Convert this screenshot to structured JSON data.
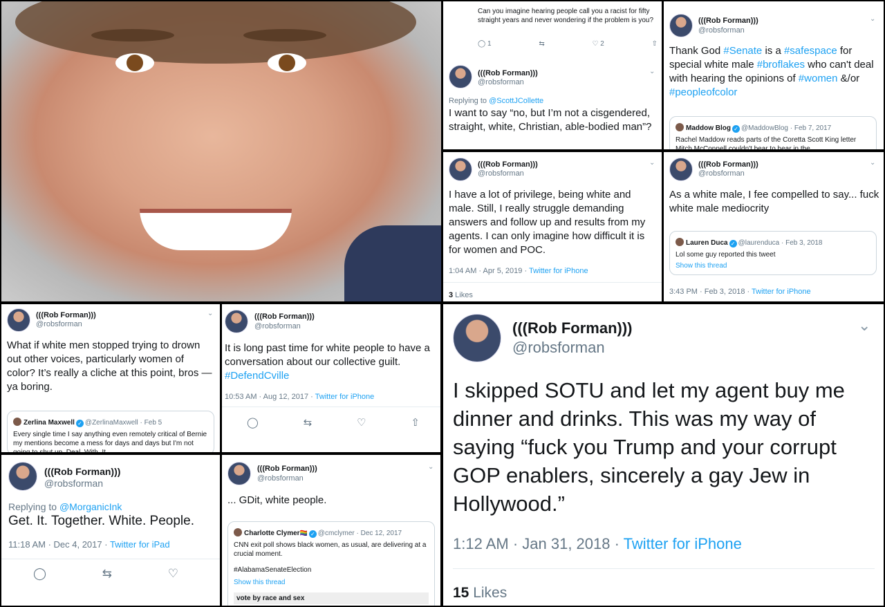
{
  "p2": {
    "quoted_text": "Can you imagine hearing people call you a racist for fifty straight years and never wondering if the problem is you?",
    "reply_count": "1",
    "like_count": "2",
    "name": "(((Rob Forman)))",
    "handle": "@robsforman",
    "replying_prefix": "Replying to ",
    "replying_to": "@ScottJCollette",
    "text": "I want to say “no, but I’m not a cisgendered, straight, white, Christian, able-bodied man”?"
  },
  "p3": {
    "name": "(((Rob Forman)))",
    "handle": "@robsforman",
    "text_1": "Thank God ",
    "tag_1": "#Senate",
    "text_2": " is a ",
    "tag_2": "#safespace",
    "text_3": " for special white male ",
    "tag_3": "#broflakes",
    "text_4": " who can't deal with hearing the opinions of ",
    "tag_4": "#women",
    "text_5": " &/or ",
    "tag_5": "#peopleofcolor",
    "quote_name": "Maddow Blog",
    "quote_handle": "@MaddowBlog · Feb 7, 2017",
    "quote_text": "Rachel Maddow reads parts of the Coretta Scott King letter Mitch McConnell couldn't bear to hear in the"
  },
  "p4": {
    "name": "(((Rob Forman)))",
    "handle": "@robsforman",
    "text": "I have a lot of privilege, being white and male. Still, I really struggle demanding answers and follow up and results from my agents. I can only imagine how difficult it is for women and POC.",
    "time": "1:04 AM · Apr 5, 2019 · ",
    "source": "Twitter for iPhone",
    "likes_count": "3",
    "likes_label": " Likes"
  },
  "p5": {
    "name": "(((Rob Forman)))",
    "handle": "@robsforman",
    "text": "As a white male, I fee compelled to say... fuck white male mediocrity",
    "quote_name": "Lauren Duca",
    "quote_handle": "@laurenduca · Feb 3, 2018",
    "quote_text": "Lol some guy reported this tweet",
    "quote_link": "Show this thread",
    "time": "3:43 PM · Feb 3, 2018 · ",
    "source": "Twitter for iPhone"
  },
  "p6": {
    "name": "(((Rob Forman)))",
    "handle": "@robsforman",
    "text": "What if white men stopped trying to drown out other voices, particularly women of color? It’s really a cliche at this point, bros — ya boring.",
    "quote_name": "Zerlina Maxwell",
    "quote_handle": "@ZerlinaMaxwell · Feb 5",
    "quote_text": "Every single time I say anything even remotely critical of Bernie my mentions become a mess for days and days but I'm not going to shut up. Deal. With. It."
  },
  "p7": {
    "name": "(((Rob Forman)))",
    "handle": "@robsforman",
    "text": "It is long past time for white people to have a conversation about our collective guilt. ",
    "tag": "#DefendCville",
    "time": "10:53 AM · Aug 12, 2017 · ",
    "source": "Twitter for iPhone"
  },
  "p8": {
    "name": "(((Rob Forman)))",
    "handle": "@robsforman",
    "replying_prefix": "Replying to ",
    "replying_to": "@MorganicInk",
    "text": "Get. It. Together. White. People.",
    "time": "11:18 AM · Dec 4, 2017 · ",
    "source": "Twitter for iPad"
  },
  "p9": {
    "name": "(((Rob Forman)))",
    "handle": "@robsforman",
    "text": "... GDit, white people.",
    "quote_name": "Charlotte Clymer",
    "quote_flag": "🏳️‍🌈",
    "quote_handle": "@cmclymer · Dec 12, 2017",
    "quote_text": "CNN exit poll shows black women, as usual, are delivering at a crucial moment.",
    "quote_tag": "#AlabamaSenateElection",
    "quote_link": "Show this thread",
    "quote_footer": "vote by race and sex"
  },
  "p10": {
    "name": "(((Rob Forman)))",
    "handle": "@robsforman",
    "text": "I skipped SOTU and let my agent buy me dinner and drinks. This was my way of saying “fuck you Trump and your corrupt GOP enablers, sincerely a gay Jew in Hollywood.”",
    "time": "1:12 AM · Jan 31, 2018 · ",
    "source": "Twitter for iPhone",
    "likes_count": "15",
    "likes_label": " Likes"
  },
  "icons": {
    "reply": "reply-icon",
    "retweet": "retweet-icon",
    "like": "heart-icon",
    "share": "share-icon",
    "chevron": "chevron-down-icon",
    "verified": "verified-icon"
  },
  "colors": {
    "link": "#1da1f2",
    "text": "#14171a",
    "muted": "#657786"
  }
}
